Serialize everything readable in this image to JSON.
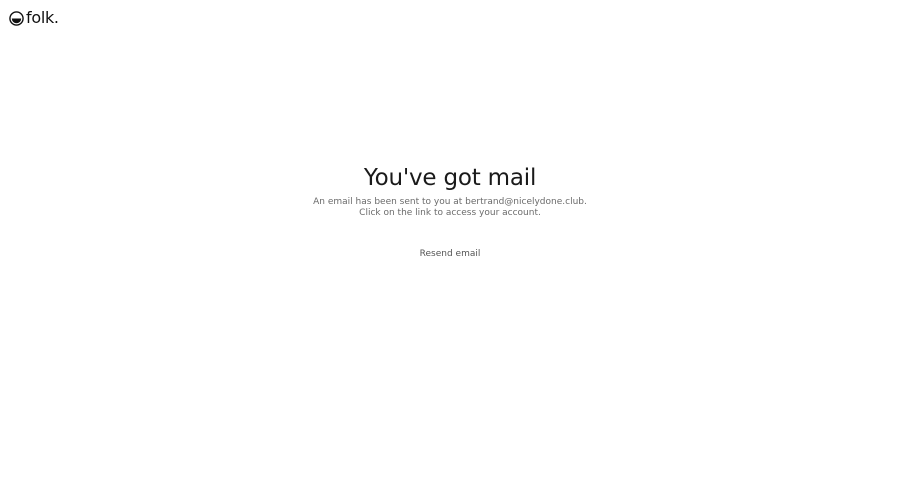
{
  "brand": {
    "logo_text": "folk."
  },
  "main": {
    "title": "You've got mail",
    "description_line1": "An email has been sent to you at bertrand@nicelydone.club.",
    "description_line2": "Click on the link to access your account.",
    "resend_label": "Resend email"
  },
  "icons": {
    "logo": "folk-logo-icon"
  },
  "colors": {
    "background": "#ffffff",
    "title": "#1a1a1a",
    "description": "#6b6b6b",
    "button_text": "#555555"
  }
}
